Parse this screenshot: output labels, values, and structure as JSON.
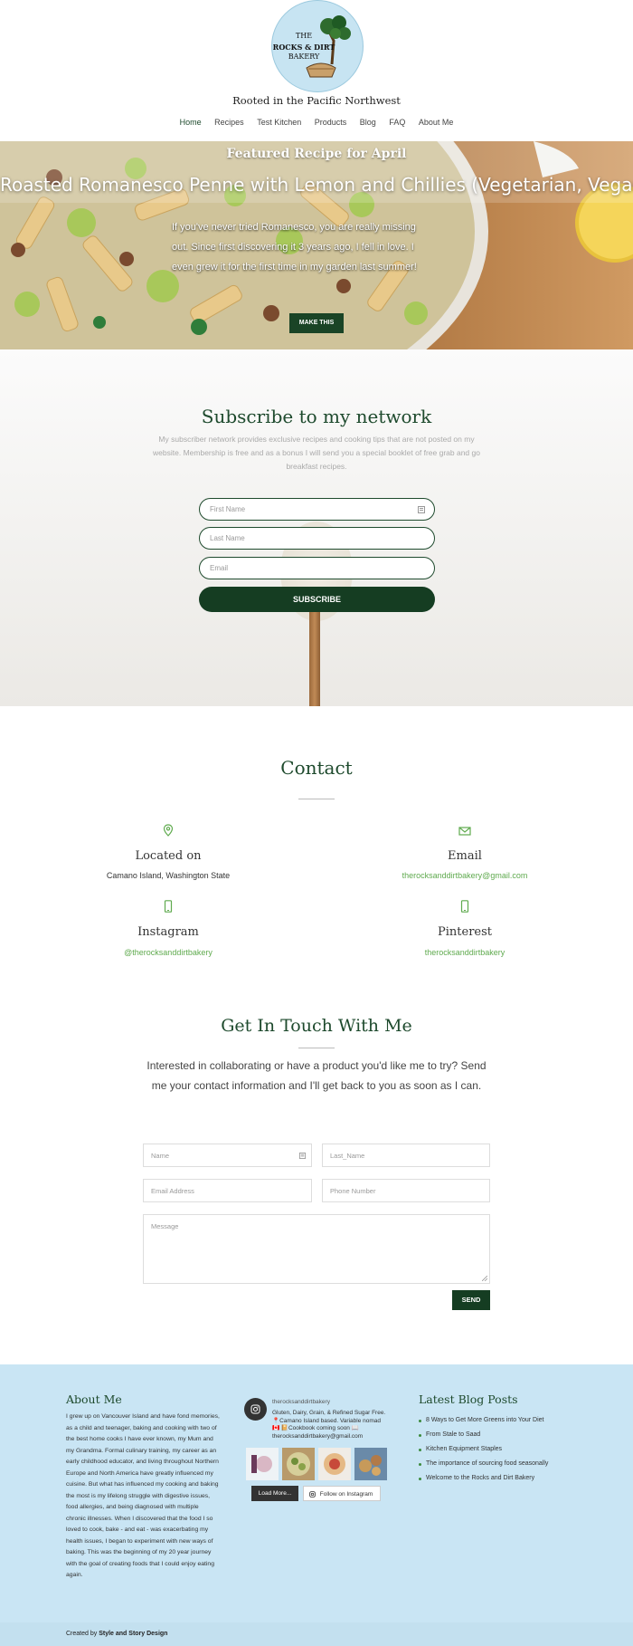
{
  "header": {
    "logo_line1": "THE",
    "logo_line2": "ROCKS & DIRT",
    "logo_line3": "BAKERY",
    "tagline": "Rooted in the Pacific Northwest",
    "nav": [
      "Home",
      "Recipes",
      "Test Kitchen",
      "Products",
      "Blog",
      "FAQ",
      "About Me"
    ]
  },
  "hero": {
    "kicker": "Featured Recipe for April",
    "title": "Roasted Romanesco Penne with Lemon and Chillies (Vegetarian, Vegan)",
    "text": "If you've never tried Romanesco, you are really missing out. Since first discovering it 3 years ago, I fell in love. I even grew it for the first time in my garden last summer!",
    "button": "MAKE THIS"
  },
  "subscribe": {
    "title": "Subscribe to my network",
    "description": "My subscriber network provides exclusive recipes and cooking tips that are not posted on my website.  Membership is free and as a bonus I will send you a special booklet of free grab and go breakfast recipes.",
    "first_name_ph": "First Name",
    "last_name_ph": "Last Name",
    "email_ph": "Email",
    "button": "SUBSCRIBE"
  },
  "contact": {
    "title": "Contact",
    "location_title": "Located on",
    "location_value": "Camano Island, Washington State",
    "email_title": "Email",
    "email_value": "therocksanddirtbakery@gmail.com",
    "instagram_title": "Instagram",
    "instagram_value": "@therocksanddirtbakery",
    "pinterest_title": "Pinterest",
    "pinterest_value": "therocksanddirtbakery"
  },
  "get_in_touch": {
    "title": "Get In Touch With Me",
    "description": "Interested in collaborating or have a product you'd like me to try? Send me your contact information and I'll get back to you as soon as I can.",
    "name_ph": "Name",
    "last_name_ph": "Last_Name",
    "email_ph": "Email Address",
    "phone_ph": "Phone Number",
    "message_ph": "Message",
    "button": "SEND"
  },
  "footer": {
    "about_title": "About Me",
    "about_text": "I grew up on Vancouver Island and have fond memories, as a child and teenager, baking and cooking with two of the best home cooks I have ever known, my Mum and my Grandma. Formal culinary training, my career as an early childhood educator, and living throughout Northern Europe and North America have greatly influenced my cuisine. But what has influenced my cooking and baking the most is my lifelong struggle with digestive issues, food allergies, and being diagnosed with multiple chronic illnesses. When I discovered that the food I so loved to cook, bake - and eat - was exacerbating my health issues, I began to experiment with new ways of baking. This was the beginning of my 20 year journey with the goal of creating foods that I could enjoy eating again.",
    "ig_username": "therocksanddirtbakery",
    "ig_bio": "Gluten, Dairy, Grain, & Refined Sugar Free. 📍Camano Island based. Variable nomad🇨🇦 📔Cookbook coming soon 📖 therocksanddirtbakery@gmail.com",
    "ig_load_more": "Load More...",
    "ig_follow": "Follow on Instagram",
    "blog_title": "Latest Blog Posts",
    "blog_posts": [
      "8 Ways to Get More Greens into Your Diet",
      "From Stale to Saad",
      "Kitchen Equipment Staples",
      "The importance of sourcing food seasonally",
      "Welcome to the Rocks and Dirt Bakery"
    ],
    "credit_prefix": "Created by",
    "credit_name": "Style and Story Design"
  },
  "colors": {
    "brand_green": "#1e4a2d",
    "link_green": "#5faa4e",
    "footer_blue": "#c9e5f4"
  }
}
